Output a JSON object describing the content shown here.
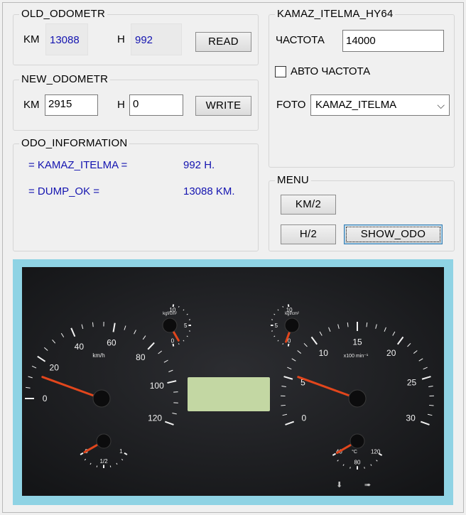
{
  "old_odometr": {
    "title": "OLD_ODOMETR",
    "km_label": "KM",
    "km_value": "13088",
    "h_label": "H",
    "h_value": "992",
    "read_button": "READ"
  },
  "new_odometr": {
    "title": "NEW_ODOMETR",
    "km_label": "KM",
    "km_value": "2915",
    "h_label": "H",
    "h_value": "0",
    "write_button": "WRITE"
  },
  "odo_information": {
    "title": "ODO_INFORMATION",
    "rows": [
      {
        "label": "= KAMAZ_ITELMA =",
        "value": "992 H."
      },
      {
        "label": "= DUMP_OK =",
        "value": "13088 KM."
      }
    ]
  },
  "device": {
    "title": "KAMAZ_ITELMA_HY64",
    "freq_label": "ЧАСТОТА",
    "freq_value": "14000",
    "auto_freq_label": "АВТО ЧАСТОТА",
    "auto_freq_checked": false,
    "photo_label": "FOTO",
    "photo_selected": "KAMAZ_ITELMA"
  },
  "menu": {
    "title": "MENU",
    "km2_button": "KM/2",
    "h2_button": "H/2",
    "show_odo_button": "SHOW_ODO"
  },
  "dashboard": {
    "speedo_ticks": [
      "0",
      "20",
      "40",
      "60",
      "80",
      "100",
      "120"
    ],
    "speedo_unit": "km/h",
    "tacho_ticks": [
      "0",
      "5",
      "10",
      "15",
      "20",
      "25",
      "30"
    ],
    "tacho_unit": "x100 min⁻¹",
    "pressure_ticks": [
      "0",
      "5",
      "10"
    ],
    "pressure_unit": "kgf/cm²",
    "temp_ticks": [
      "40",
      "80",
      "120"
    ],
    "temp_unit": "°C",
    "fuel_ticks": [
      "0",
      "1/2",
      "1"
    ],
    "needle_color": "#e2461c",
    "lcd_color": "#c3d7a3",
    "frame_color": "#8fd3e4"
  }
}
